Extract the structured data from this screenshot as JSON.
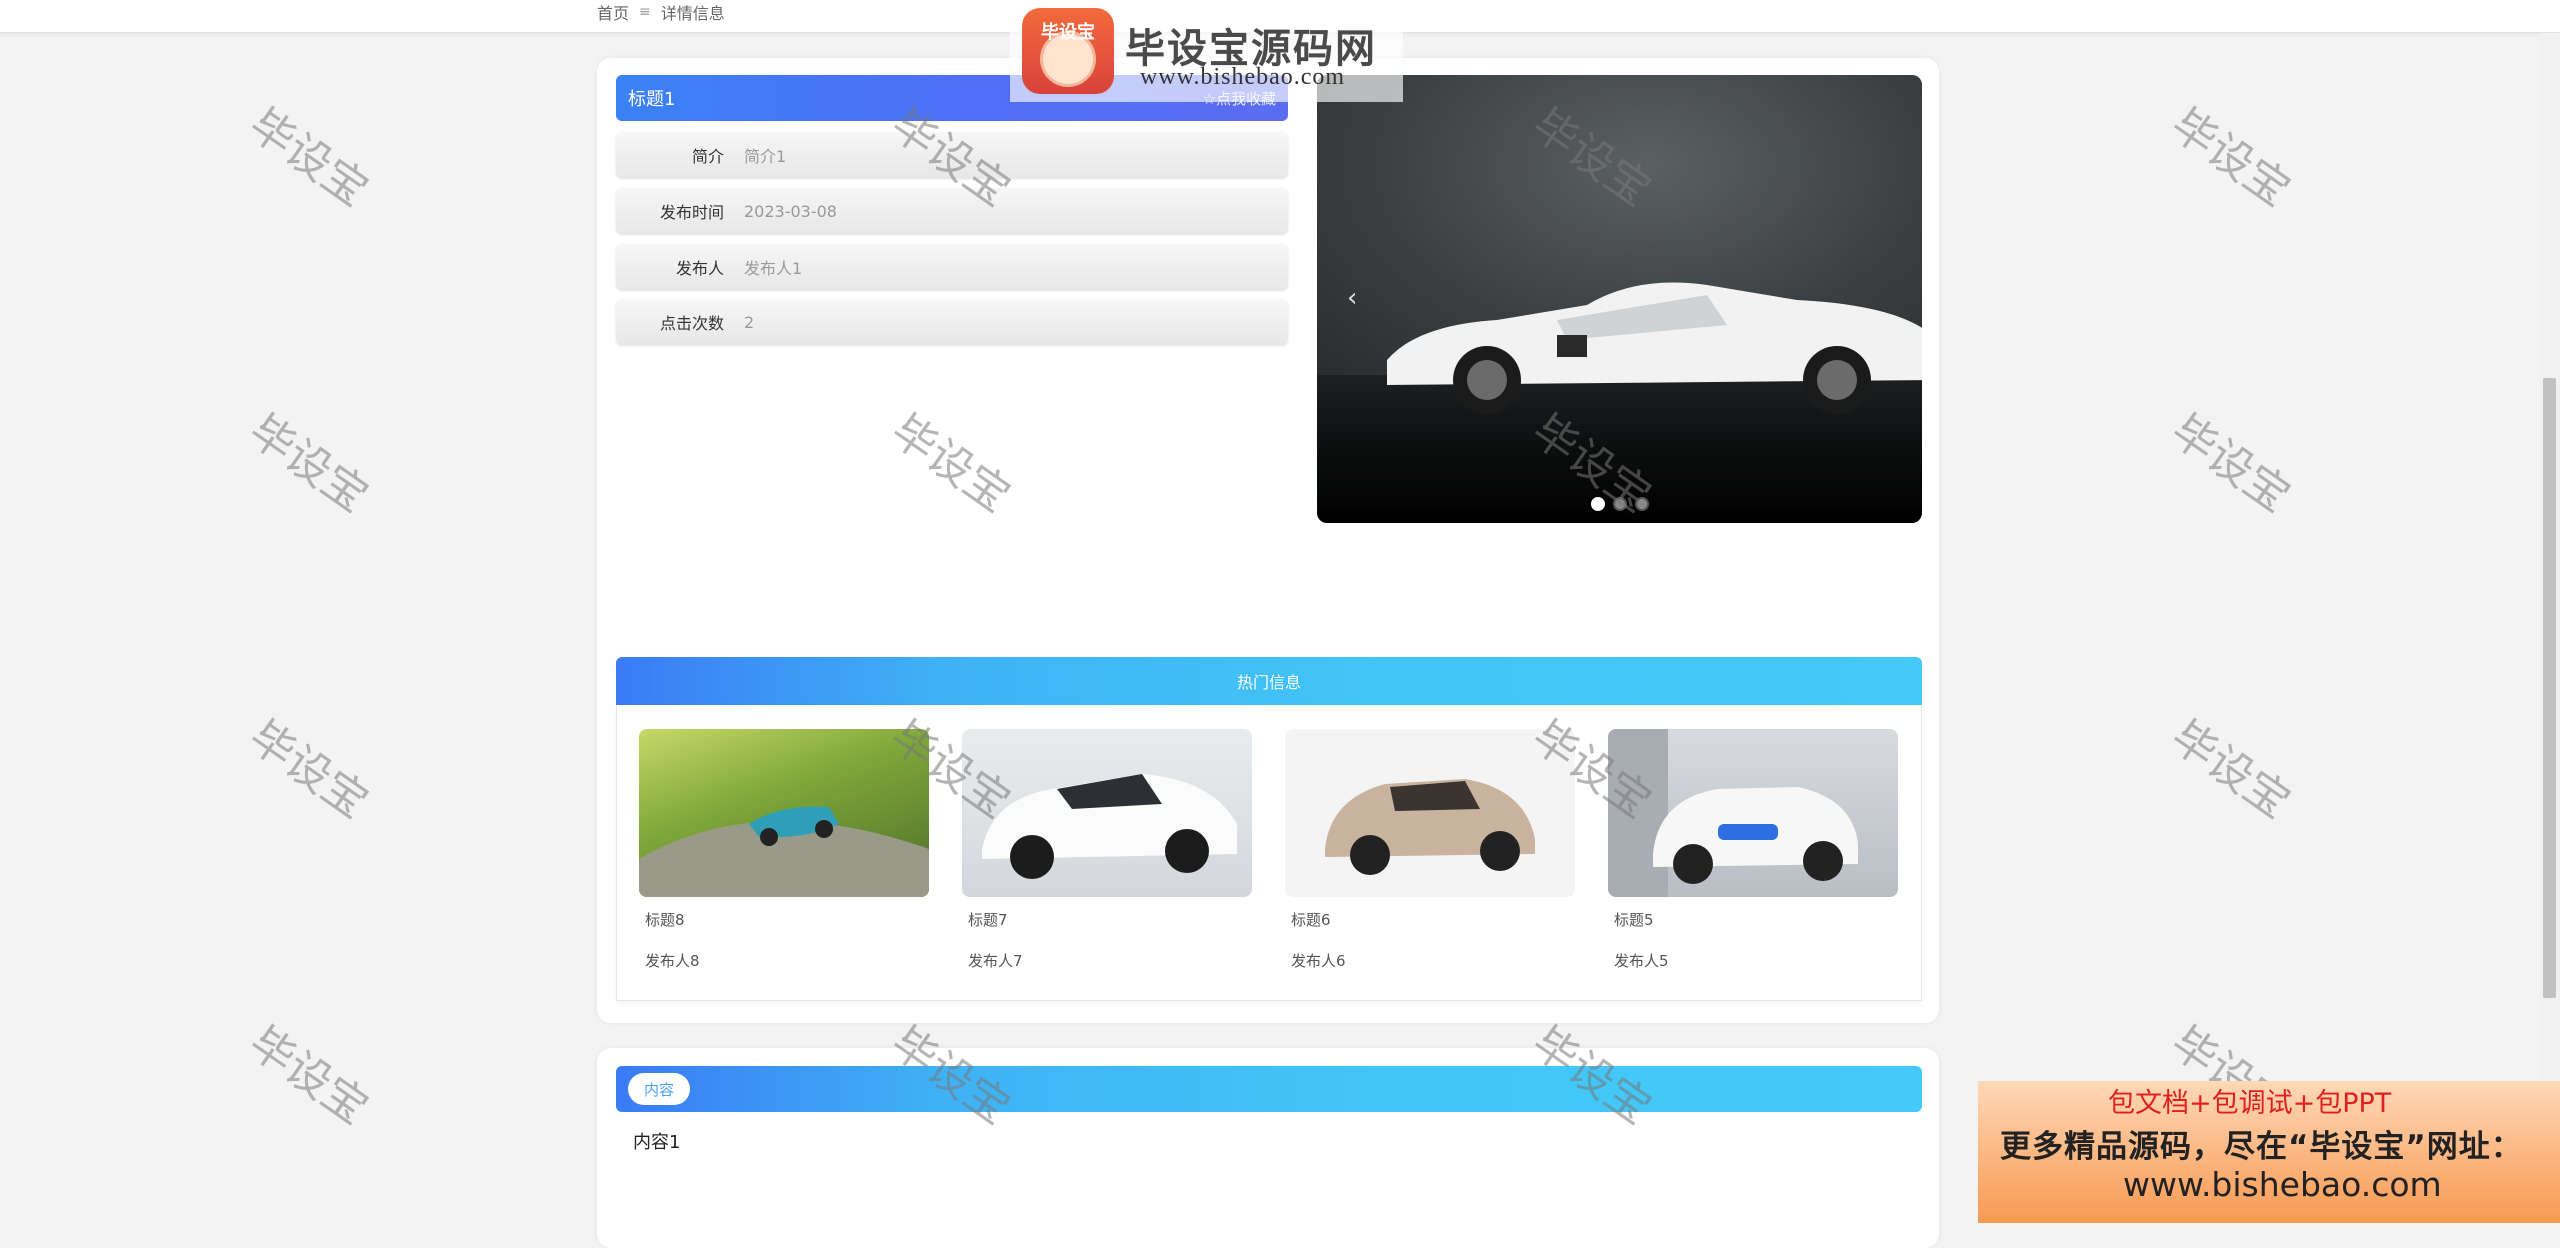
{
  "breadcrumb": {
    "home": "首页",
    "separator": "≡",
    "current": "详情信息"
  },
  "logo": {
    "badge": "毕设宝",
    "title": "毕设宝源码网",
    "url": "www.bishebao.com"
  },
  "detail": {
    "title": "标题1",
    "collect_label": "☆点我收藏",
    "rows": [
      {
        "label": "简介",
        "value": "简介1"
      },
      {
        "label": "发布时间",
        "value": "2023-03-08"
      },
      {
        "label": "发布人",
        "value": "发布人1"
      },
      {
        "label": "点击次数",
        "value": "2"
      }
    ]
  },
  "carousel": {
    "prev_icon": "‹",
    "slide_count": 3,
    "active_index": 0
  },
  "hot": {
    "header": "热门信息",
    "items": [
      {
        "title": "标题8",
        "author": "发布人8"
      },
      {
        "title": "标题7",
        "author": "发布人7"
      },
      {
        "title": "标题6",
        "author": "发布人6"
      },
      {
        "title": "标题5",
        "author": "发布人5"
      }
    ]
  },
  "content": {
    "tab_label": "内容",
    "body": "内容1"
  },
  "watermark": "毕设宝",
  "ad": {
    "line1": "包文档+包调试+包PPT",
    "line2": "更多精品源码，尽在“毕设宝”网址：",
    "line3": "www.bishebao.com"
  },
  "colors": {
    "accent_blue": "#4f6df5",
    "accent_cyan": "#42c6f7",
    "page_bg": "#f3f3f3"
  }
}
